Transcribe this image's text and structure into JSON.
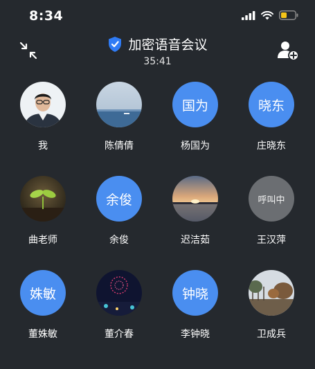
{
  "status": {
    "time": "8:34"
  },
  "header": {
    "title": "加密语音会议",
    "timer": "35:41"
  },
  "participants": [
    {
      "name": "我",
      "avatar_type": "photo",
      "avatar_text": ""
    },
    {
      "name": "陈倩倩",
      "avatar_type": "photo",
      "avatar_text": ""
    },
    {
      "name": "杨国为",
      "avatar_type": "text",
      "avatar_text": "国为"
    },
    {
      "name": "庄晓东",
      "avatar_type": "text",
      "avatar_text": "晓东"
    },
    {
      "name": "曲老师",
      "avatar_type": "photo",
      "avatar_text": ""
    },
    {
      "name": "余俊",
      "avatar_type": "text",
      "avatar_text": "余俊"
    },
    {
      "name": "迟洁茹",
      "avatar_type": "photo",
      "avatar_text": ""
    },
    {
      "name": "王汉萍",
      "avatar_type": "calling",
      "avatar_text": "呼叫中"
    },
    {
      "name": "董姝敏",
      "avatar_type": "text",
      "avatar_text": "姝敏"
    },
    {
      "name": "董介春",
      "avatar_type": "photo",
      "avatar_text": ""
    },
    {
      "name": "李钟晓",
      "avatar_type": "text",
      "avatar_text": "钟晓"
    },
    {
      "name": "卫成兵",
      "avatar_type": "photo",
      "avatar_text": ""
    }
  ],
  "colors": {
    "background": "#25292e",
    "accent": "#4a8ef0",
    "calling": "#6b6e72",
    "shield": "#2f7bf5"
  },
  "icons": {
    "collapse": "collapse-arrows-icon",
    "shield": "shield-check-icon",
    "add_user": "add-user-icon",
    "signal": "signal-icon",
    "wifi": "wifi-icon",
    "battery": "battery-icon"
  }
}
